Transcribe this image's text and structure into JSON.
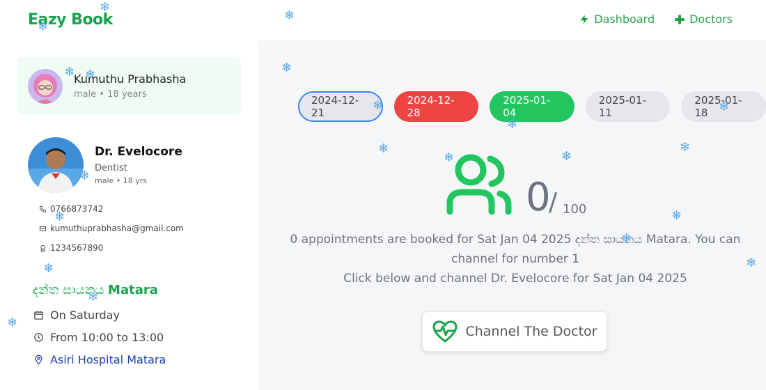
{
  "header": {
    "logo": "Eazy Book",
    "nav": [
      {
        "label": "Dashboard",
        "icon": "bolt-icon"
      },
      {
        "label": "Doctors",
        "icon": "plus-icon"
      }
    ]
  },
  "patient": {
    "name": "Kumuthu Prabhasha",
    "meta": "male • 18 years"
  },
  "doctor": {
    "name": "Dr. Evelocore",
    "specialty": "Dentist",
    "meta": "male • 18 yrs",
    "phone": "0766873742",
    "email": "kumuthuprabhasha@gmail.com",
    "id": "1234567890"
  },
  "clinic": {
    "name_si": "දන්ත සායනය",
    "name_en": "Matara",
    "day": "On Saturday",
    "time": "From 10:00 to 13:00",
    "hospital": "Asiri Hospital Matara"
  },
  "dates": [
    {
      "label": "2024-12-21",
      "state": "outlined"
    },
    {
      "label": "2024-12-28",
      "state": "red"
    },
    {
      "label": "2025-01-04",
      "state": "green"
    },
    {
      "label": "2025-01-11",
      "state": "default"
    },
    {
      "label": "2025-01-18",
      "state": "default"
    }
  ],
  "booking": {
    "booked": "0",
    "slash": "/",
    "total": "100",
    "line1": "0 appointments are booked for Sat Jan 04 2025 දන්ත සායනය Matara. You can",
    "line2": "channel for number 1",
    "line3": "Click below and channel Dr. Evelocore for Sat Jan 04 2025",
    "button": "Channel The Doctor"
  },
  "colors": {
    "brand": "#16a34a",
    "accent_green": "#22c55e",
    "accent_red": "#ef4444",
    "outline_blue": "#3b82f6"
  },
  "decor": {
    "snowflake": "❄"
  }
}
